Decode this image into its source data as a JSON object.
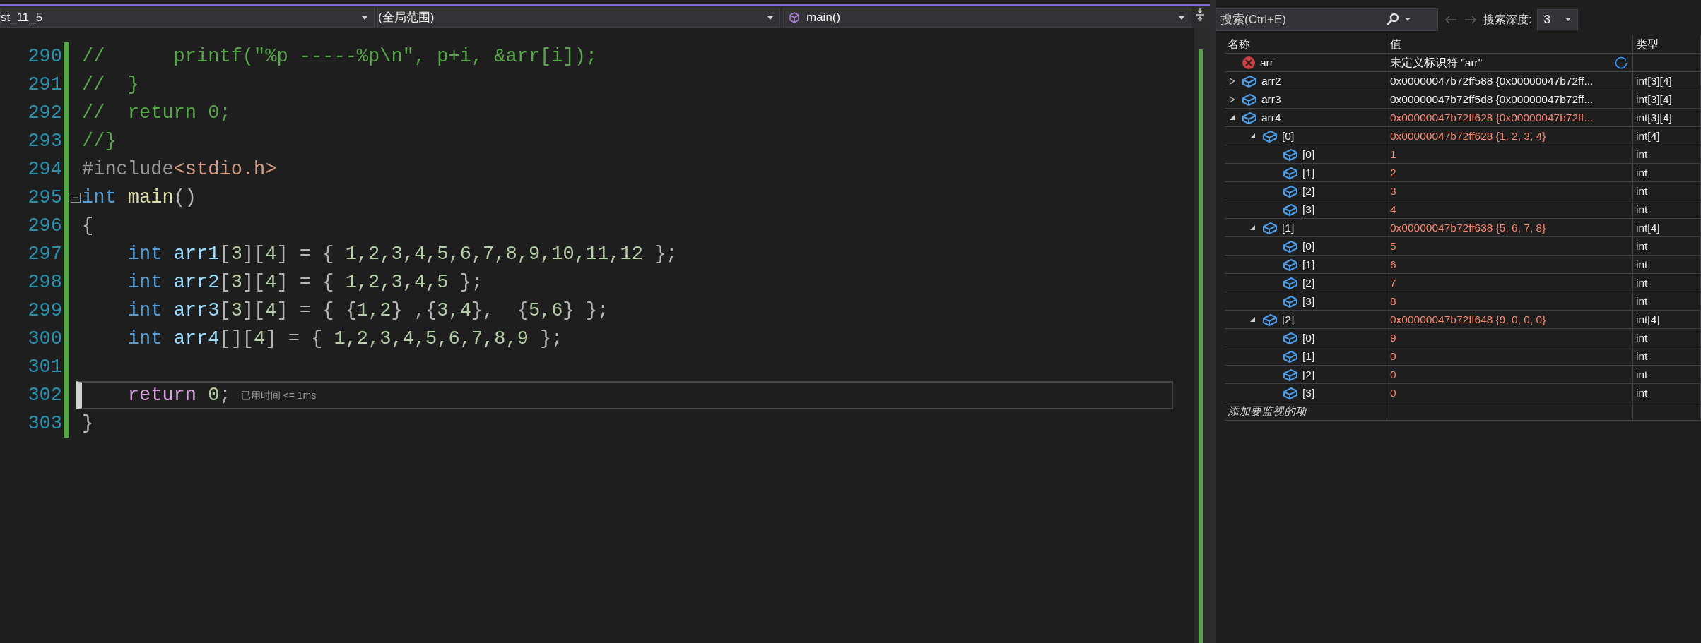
{
  "editor": {
    "navigation_bar": {
      "project": "st_11_5",
      "scope": "(全局范围)",
      "member": "main()"
    },
    "lines": [
      {
        "number": "290",
        "tokens": [
          {
            "text": "//      printf(\"%p -----%p\\n\", p+i, &arr[i]);",
            "kind": "comment"
          }
        ]
      },
      {
        "number": "291",
        "tokens": [
          {
            "text": "//  }",
            "kind": "comment"
          }
        ]
      },
      {
        "number": "292",
        "tokens": [
          {
            "text": "//  return 0;",
            "kind": "comment"
          }
        ]
      },
      {
        "number": "293",
        "tokens": [
          {
            "text": "//}",
            "kind": "comment"
          }
        ]
      },
      {
        "number": "294",
        "tokens": [
          {
            "text": "#include",
            "kind": "preproc"
          },
          {
            "text": "<stdio.h>",
            "kind": "string"
          }
        ]
      },
      {
        "number": "295",
        "fold": true,
        "tokens": [
          {
            "text": "int ",
            "kind": "keyword"
          },
          {
            "text": "main",
            "kind": "function"
          },
          {
            "text": "()",
            "kind": "plain"
          }
        ]
      },
      {
        "number": "296",
        "tokens": [
          {
            "text": "{",
            "kind": "plain"
          }
        ]
      },
      {
        "number": "297",
        "tokens": [
          {
            "text": "    int ",
            "kind": "keyword"
          },
          {
            "text": "arr1",
            "kind": "variable"
          },
          {
            "text": "[",
            "kind": "plain"
          },
          {
            "text": "3",
            "kind": "number"
          },
          {
            "text": "][",
            "kind": "plain"
          },
          {
            "text": "4",
            "kind": "number"
          },
          {
            "text": "] = { ",
            "kind": "plain"
          },
          {
            "text": "1,2,3,4,5,6,7,8,9,10,11,12",
            "kind": "number"
          },
          {
            "text": " };",
            "kind": "plain"
          }
        ]
      },
      {
        "number": "298",
        "tokens": [
          {
            "text": "    int ",
            "kind": "keyword"
          },
          {
            "text": "arr2",
            "kind": "variable"
          },
          {
            "text": "[",
            "kind": "plain"
          },
          {
            "text": "3",
            "kind": "number"
          },
          {
            "text": "][",
            "kind": "plain"
          },
          {
            "text": "4",
            "kind": "number"
          },
          {
            "text": "] = { ",
            "kind": "plain"
          },
          {
            "text": "1,2,3,4,5",
            "kind": "number"
          },
          {
            "text": " };",
            "kind": "plain"
          }
        ]
      },
      {
        "number": "299",
        "tokens": [
          {
            "text": "    int ",
            "kind": "keyword"
          },
          {
            "text": "arr3",
            "kind": "variable"
          },
          {
            "text": "[",
            "kind": "plain"
          },
          {
            "text": "3",
            "kind": "number"
          },
          {
            "text": "][",
            "kind": "plain"
          },
          {
            "text": "4",
            "kind": "number"
          },
          {
            "text": "] = { {",
            "kind": "plain"
          },
          {
            "text": "1,2",
            "kind": "number"
          },
          {
            "text": "} ,{",
            "kind": "plain"
          },
          {
            "text": "3,4",
            "kind": "number"
          },
          {
            "text": "},  {",
            "kind": "plain"
          },
          {
            "text": "5,6",
            "kind": "number"
          },
          {
            "text": "} };",
            "kind": "plain"
          }
        ]
      },
      {
        "number": "300",
        "tokens": [
          {
            "text": "    int ",
            "kind": "keyword"
          },
          {
            "text": "arr4",
            "kind": "variable"
          },
          {
            "text": "[][",
            "kind": "plain"
          },
          {
            "text": "4",
            "kind": "number"
          },
          {
            "text": "] = { ",
            "kind": "plain"
          },
          {
            "text": "1,2,3,4,5,6,7,8,9",
            "kind": "number"
          },
          {
            "text": " };",
            "kind": "plain"
          }
        ]
      },
      {
        "number": "301"
      },
      {
        "number": "302",
        "current": true,
        "hint": "已用时间 <= 1ms",
        "tokens": [
          {
            "text": "    return ",
            "kind": "control"
          },
          {
            "text": "0",
            "kind": "number"
          },
          {
            "text": ";",
            "kind": "plain"
          }
        ]
      },
      {
        "number": "303",
        "tokens": [
          {
            "text": "}",
            "kind": "plain"
          }
        ]
      }
    ]
  },
  "watch": {
    "search": {
      "placeholder": "搜索(Ctrl+E)"
    },
    "history_buttons": [
      {
        "kind": "back",
        "disabled": true
      },
      {
        "kind": "forward",
        "disabled": true
      }
    ],
    "depth_label": "搜索深度:",
    "depth": "3",
    "columns": [
      "名称",
      "值",
      "类型"
    ],
    "rows": [
      {
        "kind": "error",
        "name": "arr",
        "value": "未定义标识符 \"arr\"",
        "changed": false,
        "refresh": true
      },
      {
        "kind": "variable",
        "name": "arr2",
        "value": "0x00000047b72ff588 {0x00000047b72ff...",
        "type": "int[3][4]",
        "changed": false,
        "expanded": false
      },
      {
        "kind": "variable",
        "name": "arr3",
        "value": "0x00000047b72ff5d8 {0x00000047b72ff...",
        "type": "int[3][4]",
        "changed": false,
        "expanded": false
      },
      {
        "kind": "variable",
        "name": "arr4",
        "value": "0x00000047b72ff628 {0x00000047b72ff...",
        "type": "int[3][4]",
        "changed": true,
        "expanded": true,
        "children": [
          {
            "kind": "variable",
            "name": "[0]",
            "value": "0x00000047b72ff628 {1, 2, 3, 4}",
            "type": "int[4]",
            "changed": true,
            "expanded": true,
            "children": [
              {
                "kind": "variable",
                "name": "[0]",
                "value": "1",
                "type": "int",
                "changed": true
              },
              {
                "kind": "variable",
                "name": "[1]",
                "value": "2",
                "type": "int",
                "changed": true
              },
              {
                "kind": "variable",
                "name": "[2]",
                "value": "3",
                "type": "int",
                "changed": true
              },
              {
                "kind": "variable",
                "name": "[3]",
                "value": "4",
                "type": "int",
                "changed": true
              }
            ]
          },
          {
            "kind": "variable",
            "name": "[1]",
            "value": "0x00000047b72ff638 {5, 6, 7, 8}",
            "type": "int[4]",
            "changed": true,
            "expanded": true,
            "children": [
              {
                "kind": "variable",
                "name": "[0]",
                "value": "5",
                "type": "int",
                "changed": true
              },
              {
                "kind": "variable",
                "name": "[1]",
                "value": "6",
                "type": "int",
                "changed": true
              },
              {
                "kind": "variable",
                "name": "[2]",
                "value": "7",
                "type": "int",
                "changed": true
              },
              {
                "kind": "variable",
                "name": "[3]",
                "value": "8",
                "type": "int",
                "changed": true
              }
            ]
          },
          {
            "kind": "variable",
            "name": "[2]",
            "value": "0x00000047b72ff648 {9, 0, 0, 0}",
            "type": "int[4]",
            "changed": true,
            "expanded": true,
            "children": [
              {
                "kind": "variable",
                "name": "[0]",
                "value": "9",
                "type": "int",
                "changed": true
              },
              {
                "kind": "variable",
                "name": "[1]",
                "value": "0",
                "type": "int",
                "changed": true
              },
              {
                "kind": "variable",
                "name": "[2]",
                "value": "0",
                "type": "int",
                "changed": true
              },
              {
                "kind": "variable",
                "name": "[3]",
                "value": "0",
                "type": "int",
                "changed": true
              }
            ]
          }
        ]
      }
    ],
    "add_row": {
      "placeholder": "添加要监视的项"
    }
  }
}
